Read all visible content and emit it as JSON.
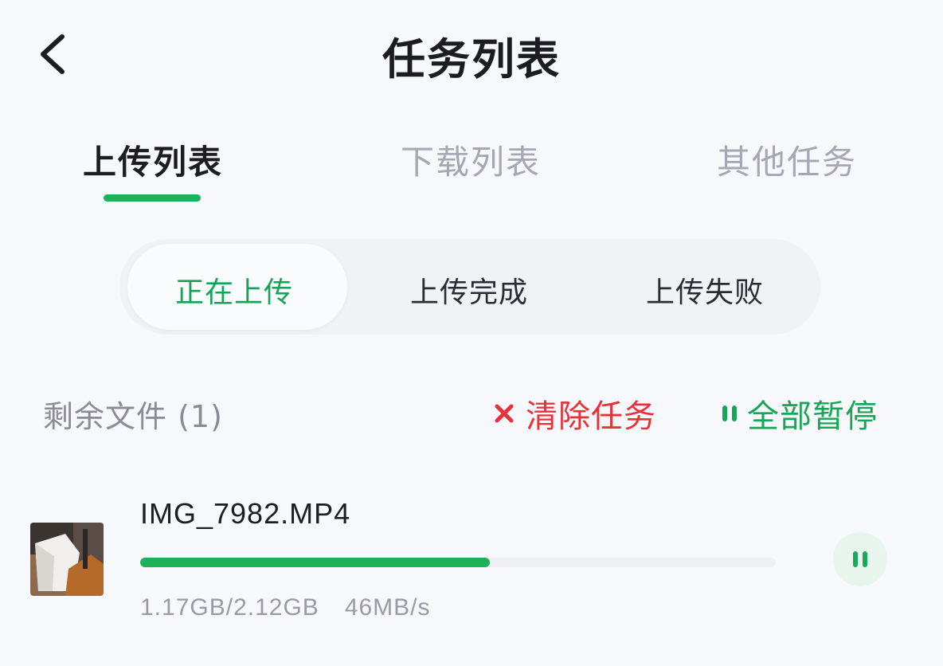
{
  "header": {
    "title": "任务列表",
    "back_icon": "chevron-left-icon"
  },
  "main_tabs": [
    {
      "label": "上传列表",
      "active": true
    },
    {
      "label": "下载列表",
      "active": false
    },
    {
      "label": "其他任务",
      "active": false
    }
  ],
  "upload_filter": [
    {
      "label": "正在上传",
      "active": true
    },
    {
      "label": "上传完成",
      "active": false
    },
    {
      "label": "上传失败",
      "active": false
    }
  ],
  "toolbar": {
    "remaining_label": "剩余文件 (1)",
    "clear_label": "清除任务",
    "clear_icon": "close-icon",
    "pause_all_label": "全部暂停",
    "pause_all_icon": "pause-icon"
  },
  "tasks": [
    {
      "file_name": "IMG_7982.MP4",
      "progress_fraction": 0.55,
      "size_progress": "1.17GB/2.12GB",
      "speed": "46MB/s",
      "thumbnail_icon": "video-thumbnail",
      "action_icon": "pause-icon"
    }
  ],
  "colors": {
    "accent_green": "#1fb15a",
    "danger_red": "#e8323a",
    "muted_text": "#a7a7b4",
    "background": "#f7f8fb"
  }
}
